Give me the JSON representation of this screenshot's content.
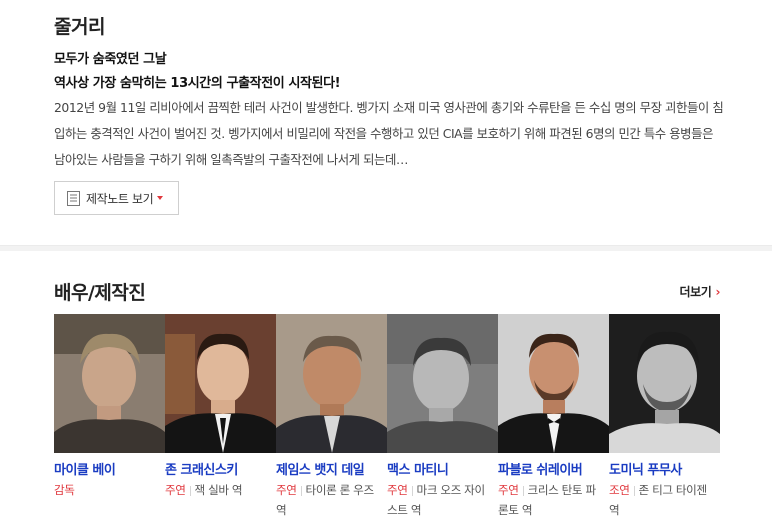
{
  "synopsis": {
    "title": "줄거리",
    "tagline1": "모두가 숨죽였던 그날",
    "tagline2": "역사상 가장 숨막히는 13시간의 구출작전이 시작된다!",
    "body": "2012년 9월 11일 리비아에서 끔찍한 테러 사건이 발생한다. 벵가지 소재 미국 영사관에 총기와 수류탄을 든 수십 명의 무장 괴한들이 침입하는 충격적인 사건이 벌어진 것. 벵가지에서 비밀리에 작전을 수행하고 있던 CIA를 보호하기 위해 파견된 6명의 민간 특수 용병들은 남아있는 사람들을 구하기 위해 일촉즉발의 구출작전에 나서게 되는데…",
    "note_button": "제작노트 보기"
  },
  "cast": {
    "title": "배우/제작진",
    "more": "더보기",
    "members": [
      {
        "name": "마이클 베이",
        "role_type": "감독",
        "role": "",
        "bg": "#7a6a5a"
      },
      {
        "name": "존 크래신스키",
        "role_type": "주연",
        "role": "잭 실바 역",
        "bg": "#5a3a2a"
      },
      {
        "name": "제임스 뱃지 데일",
        "role_type": "주연",
        "role": "타이론 론 우즈 역",
        "bg": "#9a8a7a"
      },
      {
        "name": "맥스 마티니",
        "role_type": "주연",
        "role": "마크 오즈 자이스트 역",
        "bg": "#888888"
      },
      {
        "name": "파블로 쉬레이버",
        "role_type": "주연",
        "role": "크리스 탄토 파론토 역",
        "bg": "#c9c9c9"
      },
      {
        "name": "도미닉 푸무사",
        "role_type": "조연",
        "role": "존 티그 타이젠 역",
        "bg": "#2a2a2a"
      }
    ]
  }
}
